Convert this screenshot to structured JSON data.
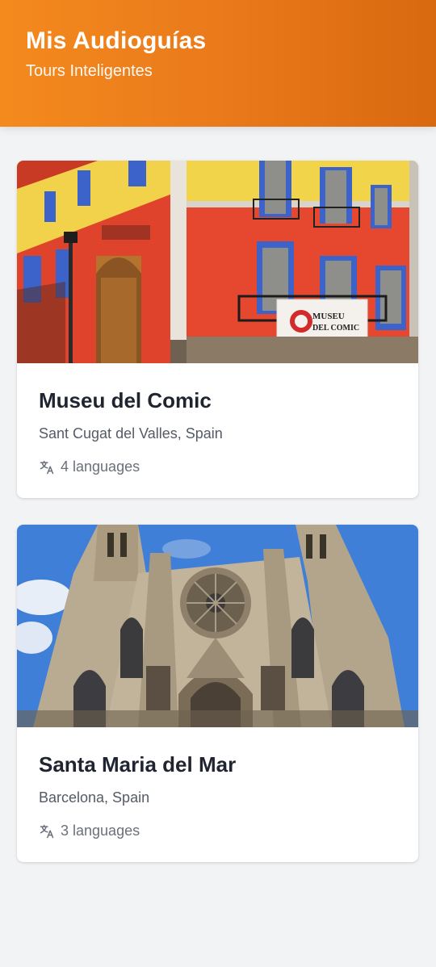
{
  "header": {
    "title": "Mis Audioguías",
    "subtitle": "Tours Inteligentes"
  },
  "tours": [
    {
      "name": "Museu del Comic",
      "location": "Sant Cugat del Valles, Spain",
      "languages": "4 languages",
      "sign_line1": "MUSEU",
      "sign_line2": "DEL COMIC"
    },
    {
      "name": "Santa Maria del Mar",
      "location": "Barcelona, Spain",
      "languages": "3 languages"
    }
  ],
  "icons": {
    "language": "translate-icon"
  },
  "colors": {
    "header_start": "#f48a1e",
    "header_end": "#d9690f",
    "background": "#f2f3f5",
    "title_text": "#1f2430"
  }
}
